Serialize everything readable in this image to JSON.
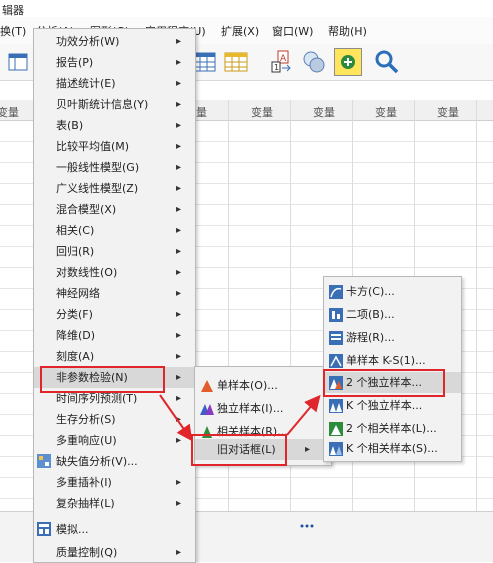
{
  "window": {
    "title": "辑器"
  },
  "menubar": {
    "items": [
      "换(T)",
      "分析(A)",
      "图形(G)",
      "实用程序(U)",
      "扩展(X)",
      "窗口(W)",
      "帮助(H)"
    ]
  },
  "grid": {
    "column_header": "变量"
  },
  "analyze_menu": {
    "items": [
      {
        "label": "功效分析(W)",
        "submenu": true
      },
      {
        "label": "报告(P)",
        "submenu": true
      },
      {
        "label": "描述统计(E)",
        "submenu": true
      },
      {
        "label": "贝叶斯统计信息(Y)",
        "submenu": true
      },
      {
        "label": "表(B)",
        "submenu": true
      },
      {
        "label": "比较平均值(M)",
        "submenu": true
      },
      {
        "label": "一般线性模型(G)",
        "submenu": true
      },
      {
        "label": "广义线性模型(Z)",
        "submenu": true
      },
      {
        "label": "混合模型(X)",
        "submenu": true
      },
      {
        "label": "相关(C)",
        "submenu": true
      },
      {
        "label": "回归(R)",
        "submenu": true
      },
      {
        "label": "对数线性(O)",
        "submenu": true
      },
      {
        "label": "神经网络",
        "submenu": true
      },
      {
        "label": "分类(F)",
        "submenu": true
      },
      {
        "label": "降维(D)",
        "submenu": true
      },
      {
        "label": "刻度(A)",
        "submenu": true
      },
      {
        "label": "非参数检验(N)",
        "submenu": true,
        "highlighted": true
      },
      {
        "label": "时间序列预测(T)",
        "submenu": true
      },
      {
        "label": "生存分析(S)",
        "submenu": true
      },
      {
        "label": "多重响应(U)",
        "submenu": true
      },
      {
        "label": "缺失值分析(V)...",
        "submenu": false,
        "icon": "missing-value-icon"
      },
      {
        "label": "多重插补(I)",
        "submenu": true
      },
      {
        "label": "复杂抽样(L)",
        "submenu": true
      },
      {
        "label": "模拟...",
        "submenu": false,
        "icon": "simulation-icon"
      },
      {
        "label": "质量控制(Q)",
        "submenu": true
      }
    ]
  },
  "nonparam_menu": {
    "items": [
      {
        "label": "单样本(O)...",
        "icon": "one-sample-icon"
      },
      {
        "label": "独立样本(I)...",
        "icon": "independent-samples-icon"
      },
      {
        "label": "相关样本(R)...",
        "icon": "related-samples-icon"
      },
      {
        "label": "旧对话框(L)",
        "submenu": true,
        "highlighted": true
      }
    ]
  },
  "legacy_menu": {
    "items": [
      {
        "label": "卡方(C)...",
        "icon": "chi-square-icon"
      },
      {
        "label": "二项(B)...",
        "icon": "binomial-icon"
      },
      {
        "label": "游程(R)...",
        "icon": "runs-icon"
      },
      {
        "label": "单样本 K-S(1)...",
        "icon": "ks-icon"
      },
      {
        "label": "2 个独立样本...",
        "icon": "two-independent-icon",
        "highlighted": true
      },
      {
        "label": "K 个独立样本...",
        "icon": "k-independent-icon"
      },
      {
        "label": "2 个相关样本(L)...",
        "icon": "two-related-icon"
      },
      {
        "label": "K 个相关样本(S)...",
        "icon": "k-related-icon"
      }
    ]
  },
  "colors": {
    "highlight_box": "#e0262a",
    "menu_bg": "#f2f2f2"
  }
}
